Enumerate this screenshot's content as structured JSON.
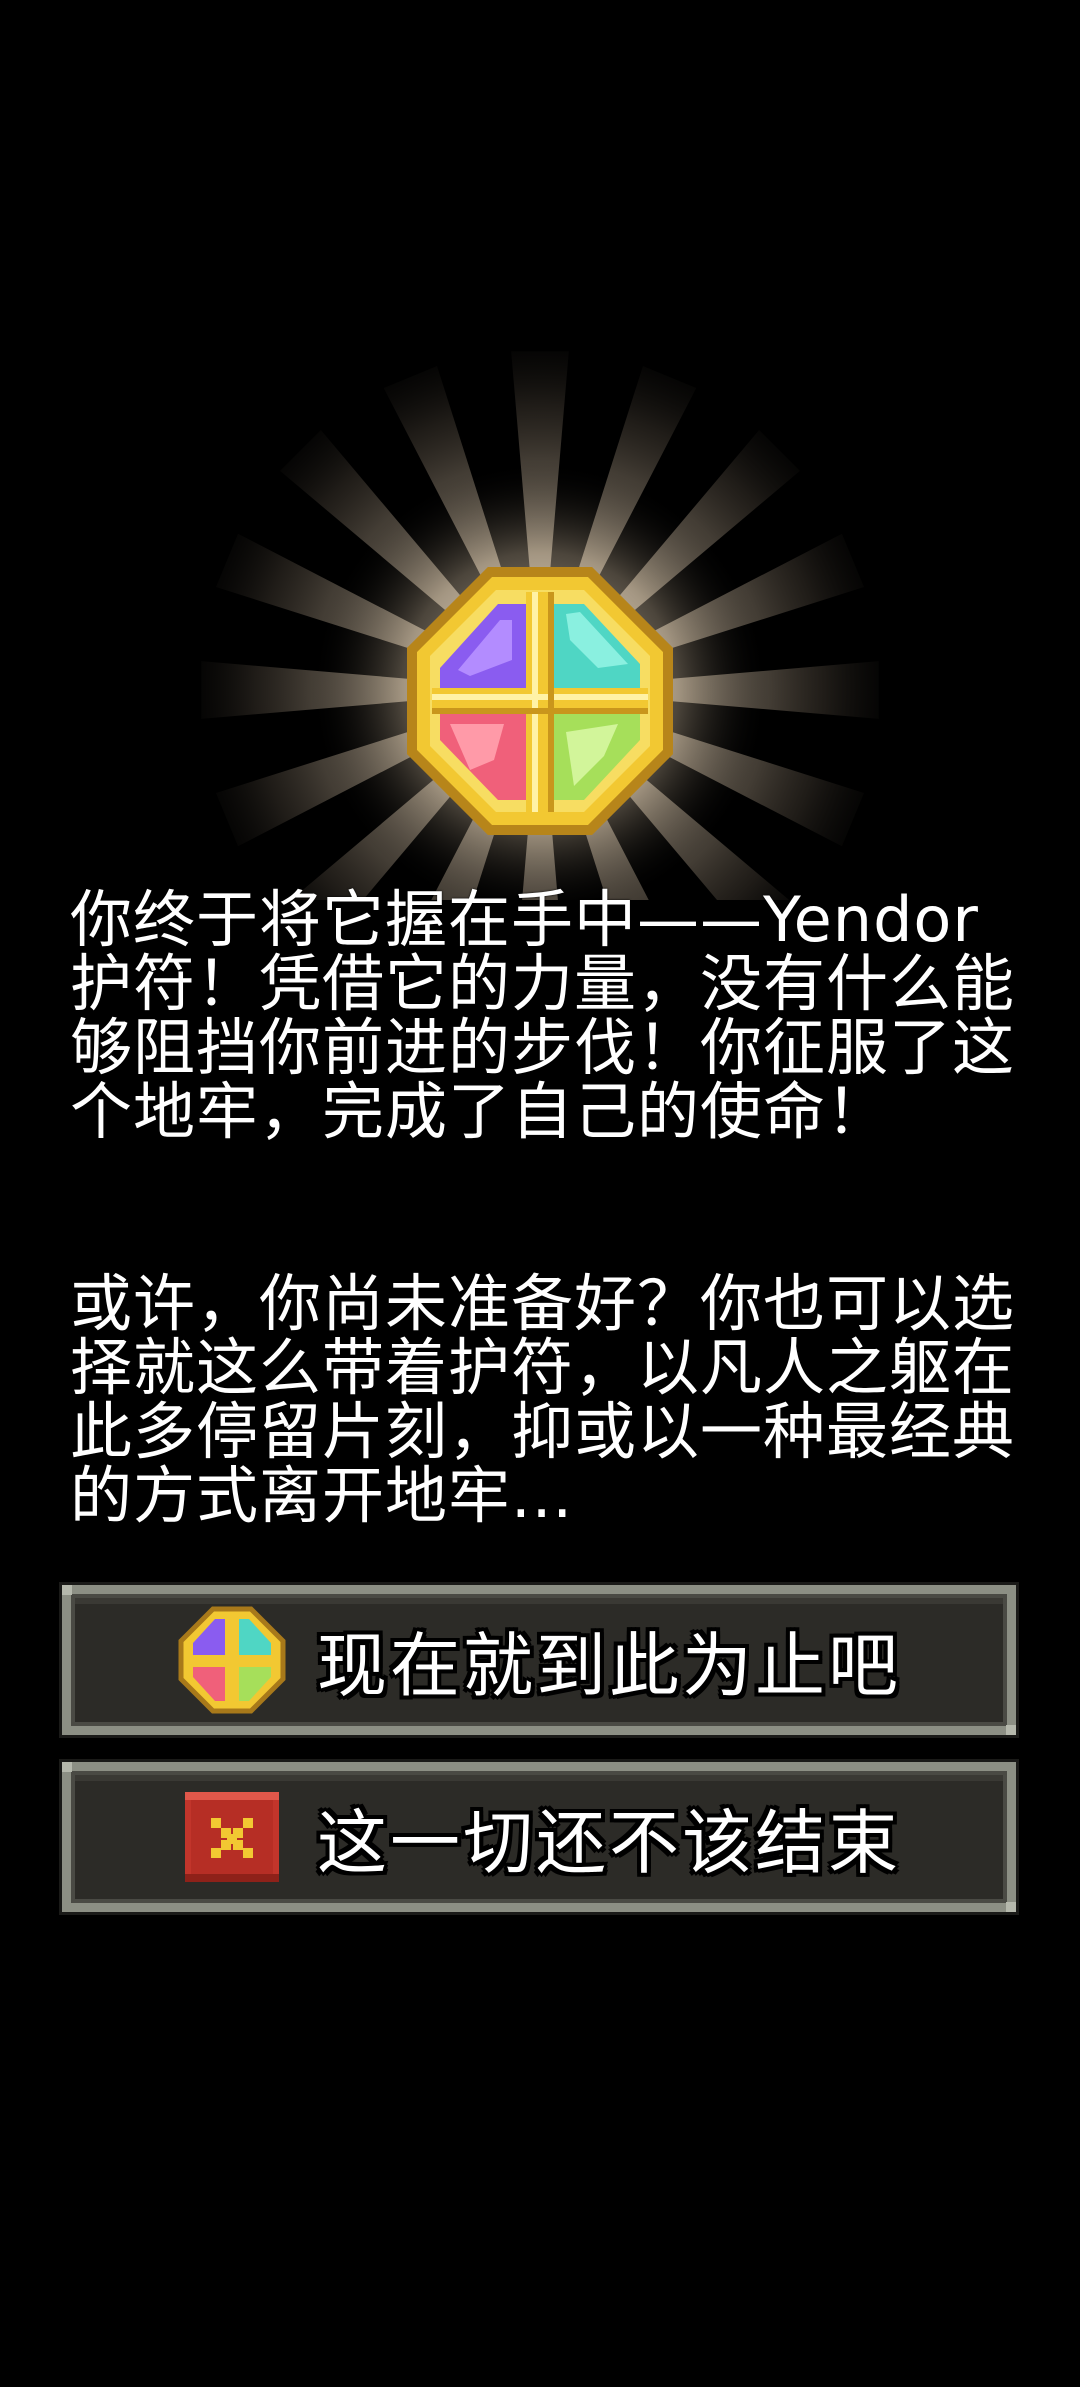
{
  "amulet": {
    "icon": "yendor-amulet-icon",
    "colors": {
      "gold": "#f2c832",
      "gold_dark": "#c9961c",
      "purple": "#8a5cf0",
      "teal": "#4fd6c4",
      "pink": "#f0607a",
      "green": "#a6df5a"
    }
  },
  "story": {
    "paragraph_1": "你终于将它握在手中——Yendor护符！凭借它的力量，没有什么能够阻挡你前进的步伐！你征服了这个地牢，完成了自己的使命！",
    "paragraph_2": "或许，你尚未准备好？你也可以选择就这么带着护符，以凡人之躯在此多停留片刻，抑或以一种最经典的方式离开地牢..."
  },
  "buttons": {
    "end_now": {
      "label": "现在就到此为止吧",
      "icon": "amulet-icon"
    },
    "not_over": {
      "label": "这一切还不该结束",
      "icon": "close-icon",
      "color": "#c2352b"
    }
  }
}
